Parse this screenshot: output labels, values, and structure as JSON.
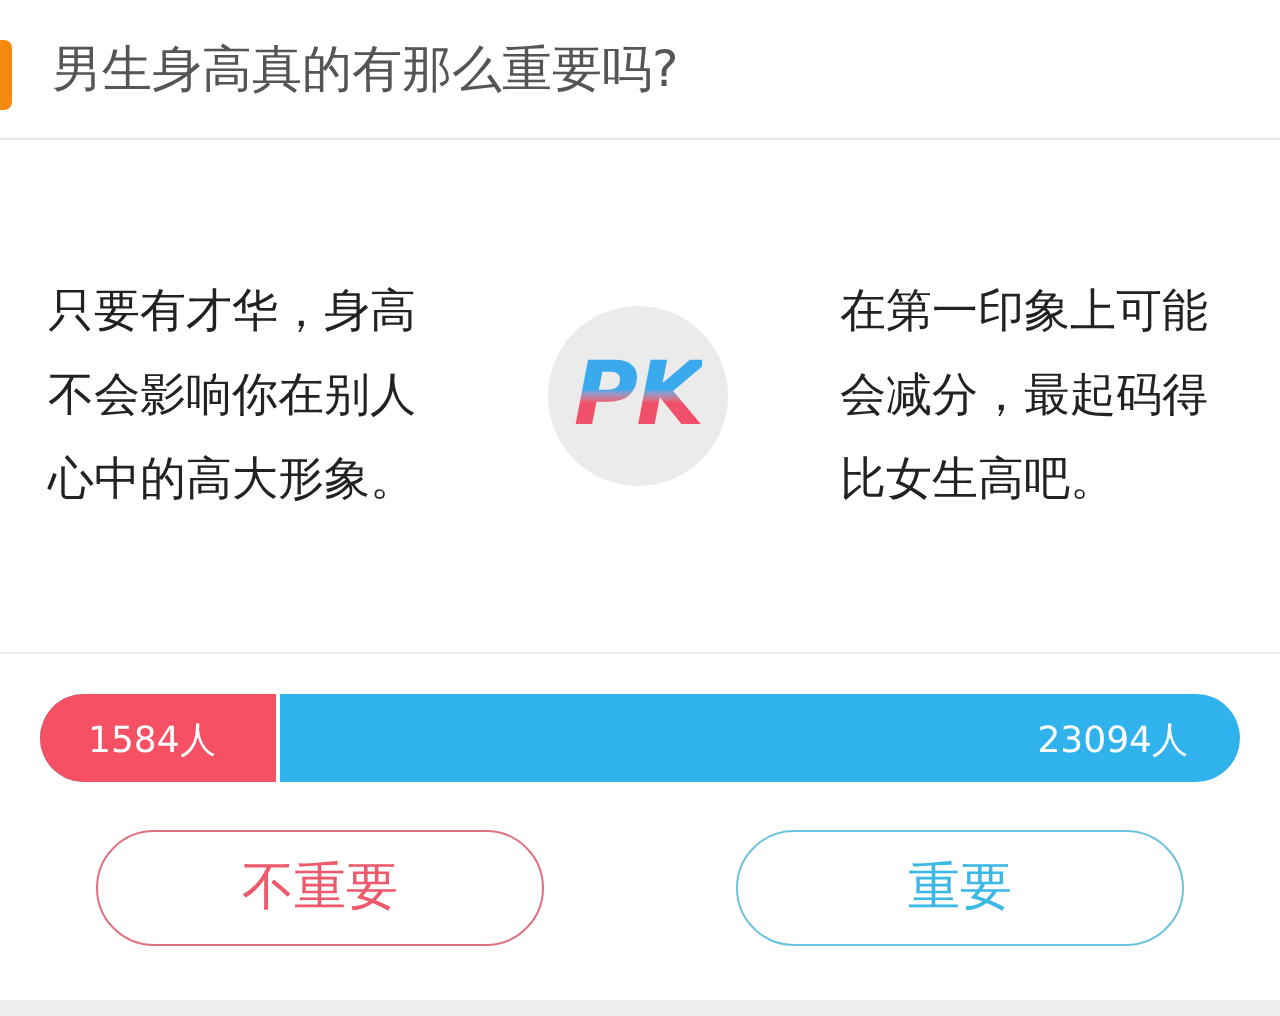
{
  "title": "男生身高真的有那么重要吗?",
  "left_opinion": "只要有才华，身高不会影响你在别人心中的高大形象。",
  "pk_badge": {
    "letters": [
      "P",
      "K"
    ]
  },
  "right_opinion": "在第一印象上可能会减分，最起码得比女生高吧。",
  "vote_bar": {
    "level": 0.2,
    "left_count": "1584人",
    "right_count": "23094人"
  },
  "buttons": [
    {
      "label": "不重要",
      "kind": "against"
    },
    {
      "label": "重要",
      "kind": "for"
    }
  ]
}
